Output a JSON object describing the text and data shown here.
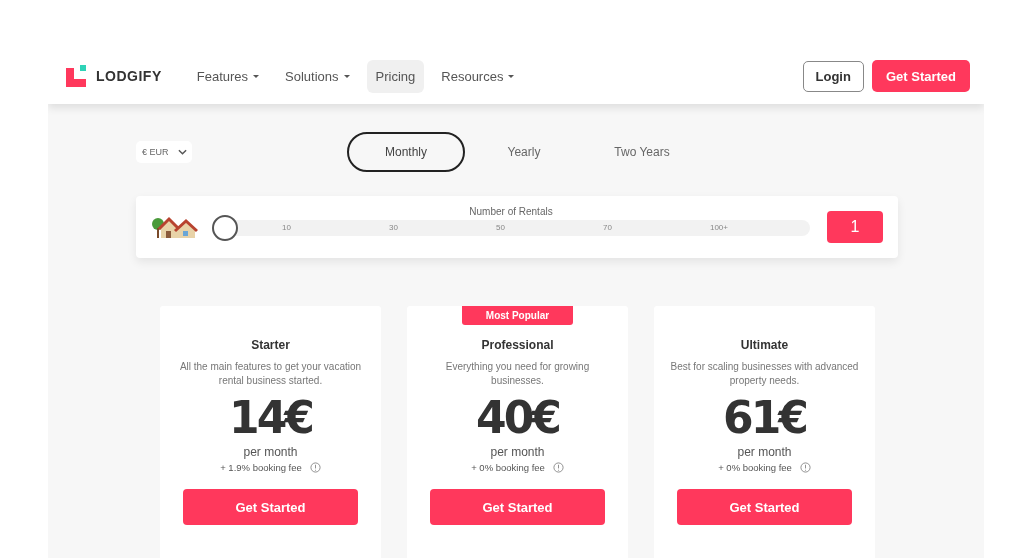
{
  "nav": {
    "logo": "LODGIFY",
    "items": [
      {
        "label": "Features",
        "dropdown": true,
        "selected": false
      },
      {
        "label": "Solutions",
        "dropdown": true,
        "selected": false
      },
      {
        "label": "Pricing",
        "dropdown": false,
        "selected": true
      },
      {
        "label": "Resources",
        "dropdown": true,
        "selected": false
      }
    ],
    "login": "Login",
    "cta": "Get Started"
  },
  "currency": {
    "value": "€ EUR"
  },
  "billing_tabs": [
    {
      "label": "Monthly",
      "selected": true
    },
    {
      "label": "Yearly",
      "selected": false
    },
    {
      "label": "Two Years",
      "selected": false
    }
  ],
  "rentals": {
    "label": "Number of Rentals",
    "level": 0,
    "ticks": [
      "10",
      "30",
      "50",
      "70",
      "100+"
    ],
    "count": "1"
  },
  "plans": [
    {
      "name": "Starter",
      "description": "All the main features to get your vacation rental business started.",
      "price": "14€",
      "period": "per month",
      "fee": "+ 1.9% booking fee",
      "button": "Get Started"
    },
    {
      "name": "Professional",
      "badge": "Most Popular",
      "description": "Everything you need for growing businesses.",
      "price": "40€",
      "period": "per month",
      "fee": "+ 0% booking fee",
      "button": "Get Started"
    },
    {
      "name": "Ultimate",
      "description": "Best for scaling businesses with advanced property needs.",
      "price": "61€",
      "period": "per month",
      "fee": "+ 0% booking fee",
      "button": "Get Started"
    }
  ]
}
